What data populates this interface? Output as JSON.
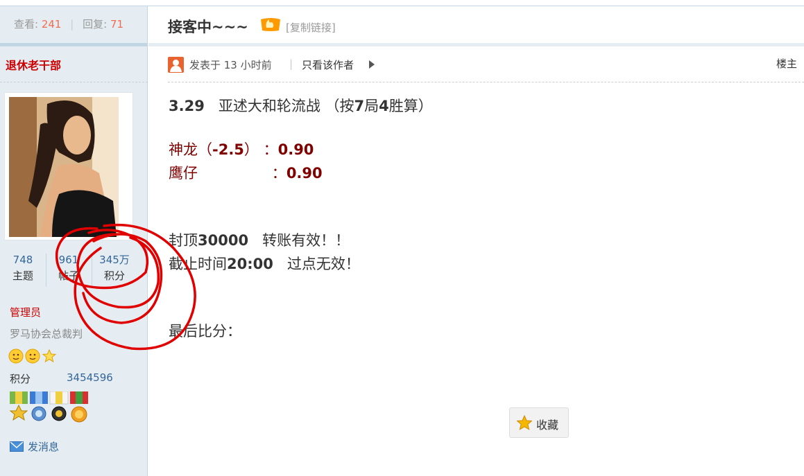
{
  "sidebar": {
    "stats": {
      "views_label": "查看:",
      "views": "241",
      "replies_label": "回复:",
      "replies": "71",
      "sep": "|"
    },
    "author_name": "退休老干部",
    "profile_stats": [
      {
        "value": "748",
        "label": "主题"
      },
      {
        "value": "961",
        "label": "帖子"
      },
      {
        "value": "345万",
        "label": "积分"
      }
    ],
    "group": "管理员",
    "user_title": "罗马协会总裁判",
    "score_label": "积分",
    "score_value": "3454596",
    "send_message": "发消息"
  },
  "header": {
    "title": "接客中~~~",
    "hot_icon": "火",
    "copy_link": "[复制链接]"
  },
  "post_meta": {
    "posted": "发表于 13 小时前",
    "sep": "|",
    "only_author": "只看该作者",
    "floor": "楼主"
  },
  "content": {
    "line1_date": "3.29",
    "line1_text": "亚述大和轮流战 （按",
    "line1_n1": "7",
    "line1_mid": "局",
    "line1_n2": "4",
    "line1_end": "胜算）",
    "odds1_team": "神龙（",
    "odds1_hcap": "-2.5",
    "odds1_mid": "）  ：",
    "odds1_val": "0.90",
    "odds2_team": "鹰仔                ：",
    "odds2_val": "0.90",
    "cap_label": "封顶",
    "cap_value": "30000",
    "cap_text": "   转账有效！！",
    "deadline_label": "截止时间",
    "deadline_time": "20:00",
    "deadline_text": "   过点无效！",
    "final_score": "最后比分："
  },
  "actions": {
    "favorite": "收藏"
  },
  "colors": {
    "accent_red": "#cc0000",
    "link_blue": "#336699",
    "odds": "#800000",
    "annotation": "#e00000",
    "sidebar_bg": "#e5edf2"
  }
}
